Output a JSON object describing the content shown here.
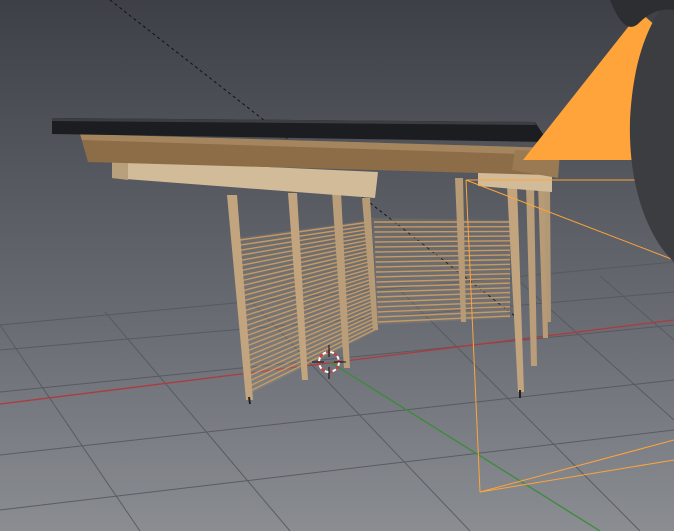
{
  "viewport": {
    "name": "3D Viewport",
    "background_top": "#3d4046",
    "background_bottom": "#8a8d92"
  },
  "scene": {
    "object": "pergola",
    "wood_color": "#c8a679",
    "roof_color": "#1b1d20",
    "slat_color": "#c79a63"
  },
  "axes": {
    "x_color": "#b03a3a",
    "y_color": "#3c8a3c"
  },
  "camera": {
    "selected": true,
    "color": "#ffa43a"
  },
  "cursor": {
    "name": "3d-cursor",
    "color_a": "#d33a3a",
    "color_b": "#ffffff"
  }
}
